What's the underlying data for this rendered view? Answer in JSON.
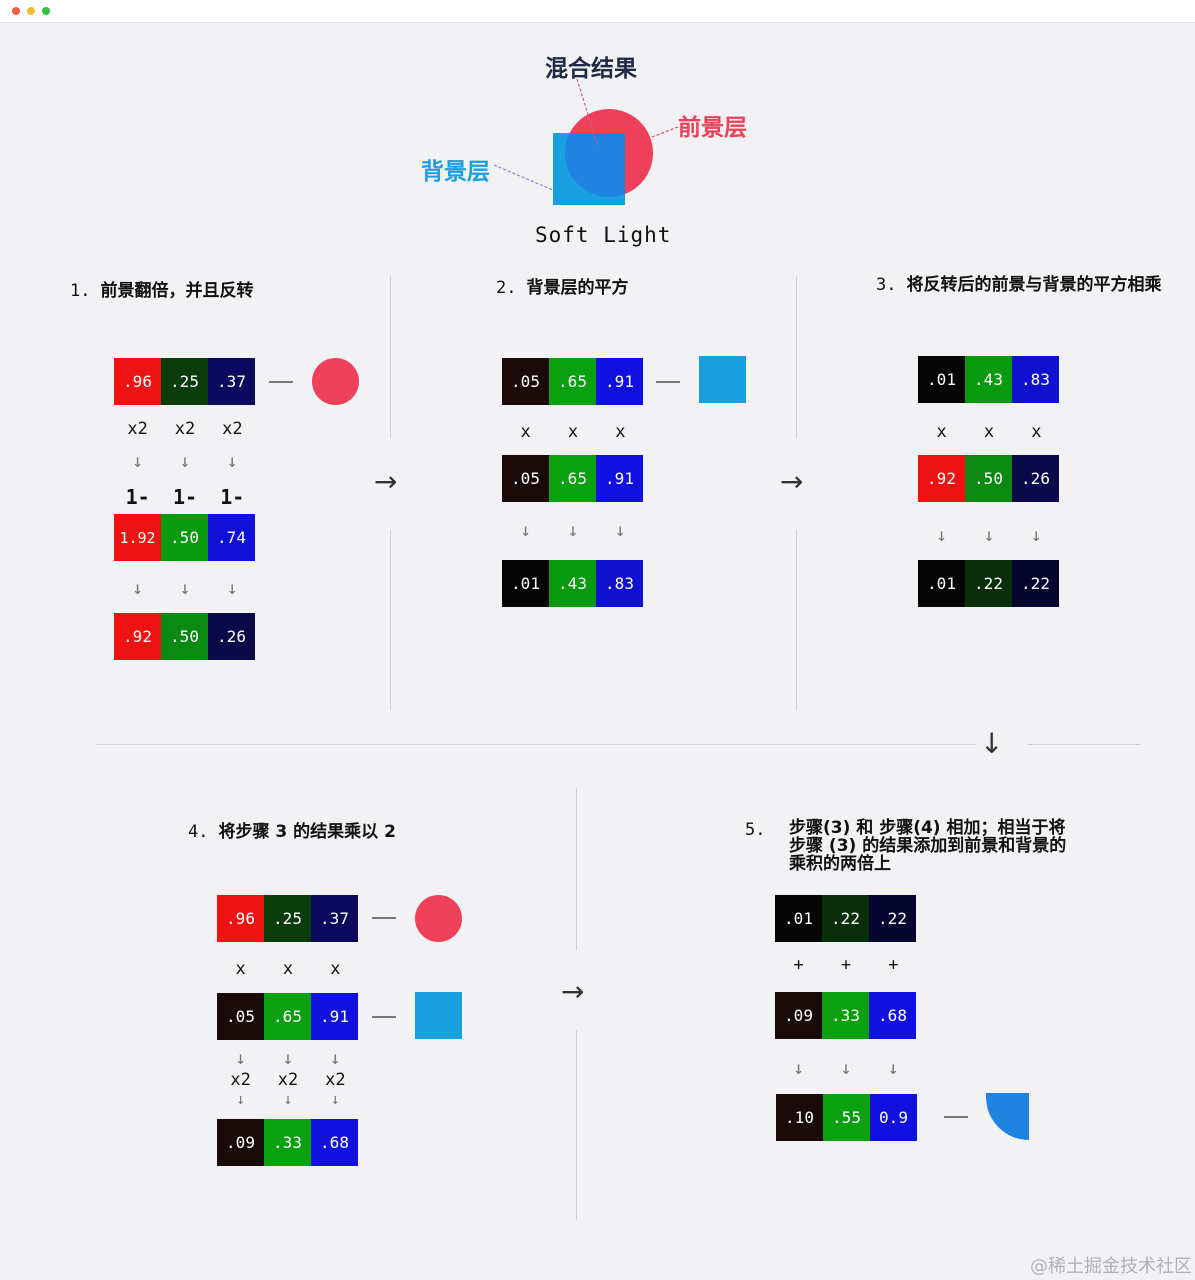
{
  "hero": {
    "title": "混合结果",
    "foreground_label": "前景层",
    "background_label": "背景层",
    "mode": "Soft Light"
  },
  "step1": {
    "num": "1.",
    "title": "前景翻倍，并且反转",
    "row_a": [
      ".96",
      ".25",
      ".37"
    ],
    "ops_a": [
      "x2",
      "x2",
      "x2"
    ],
    "arrows_a": [
      "↓",
      "↓",
      "↓"
    ],
    "ops_b": [
      "1-",
      "1-",
      "1-"
    ],
    "row_b": [
      "1.92",
      ".50",
      ".74"
    ],
    "arrows_b": [
      "↓",
      "↓",
      "↓"
    ],
    "row_c": [
      ".92",
      ".50",
      ".26"
    ]
  },
  "step2": {
    "num": "2.",
    "title": "背景层的平方",
    "row_a": [
      ".05",
      ".65",
      ".91"
    ],
    "ops_a": [
      "x",
      "x",
      "x"
    ],
    "row_b": [
      ".05",
      ".65",
      ".91"
    ],
    "arrows": [
      "↓",
      "↓",
      "↓"
    ],
    "row_c": [
      ".01",
      ".43",
      ".83"
    ]
  },
  "step3": {
    "num": "3.",
    "title": "将反转后的前景与背景的平方相乘",
    "row_a": [
      ".01",
      ".43",
      ".83"
    ],
    "ops_a": [
      "x",
      "x",
      "x"
    ],
    "row_b": [
      ".92",
      ".50",
      ".26"
    ],
    "arrows": [
      "↓",
      "↓",
      "↓"
    ],
    "row_c": [
      ".01",
      ".22",
      ".22"
    ]
  },
  "step4": {
    "num": "4.",
    "title": "将步骤 3 的结果乘以 2",
    "row_a": [
      ".96",
      ".25",
      ".37"
    ],
    "ops_a": [
      "x",
      "x",
      "x"
    ],
    "row_b": [
      ".05",
      ".65",
      ".91"
    ],
    "arrows_top": [
      "↓",
      "↓",
      "↓"
    ],
    "ops_b": [
      "x2",
      "x2",
      "x2"
    ],
    "arrows_bottom": [
      "↓",
      "↓",
      "↓"
    ],
    "row_c": [
      ".09",
      ".33",
      ".68"
    ]
  },
  "step5": {
    "num": "5.",
    "title": "步骤(3) 和 步骤(4) 相加；相当于将步骤 (3) 的结果添加到前景和背景的乘积的两倍上",
    "row_a": [
      ".01",
      ".22",
      ".22"
    ],
    "ops_a": [
      "+",
      "+",
      "+"
    ],
    "row_b": [
      ".09",
      ".33",
      ".68"
    ],
    "arrows": [
      "↓",
      "↓",
      "↓"
    ],
    "row_c": [
      ".10",
      ".55",
      "0.9"
    ]
  },
  "arrows": {
    "right": "→",
    "down": "↓"
  },
  "watermark": "@稀土掘金技术社区",
  "colors": {
    "foreground_circle": "#ee4058",
    "background_square": "#1a9fe0",
    "blend_result": "#1f84e0",
    "cell_red": "#ee1212",
    "cell_green": "#0a9a10",
    "cell_blue": "#1010d8"
  }
}
